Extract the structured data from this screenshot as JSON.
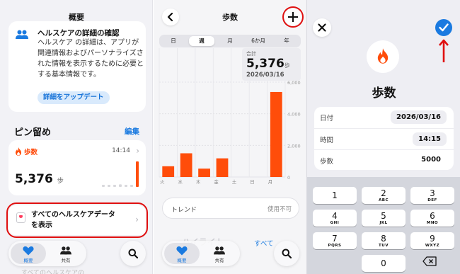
{
  "summary": {
    "title": "概要",
    "info_card": {
      "heading": "ヘルスケアの詳細の確認",
      "body": "ヘルスケア の詳細は、アプリが関連情報およびパーソナライズされた情報を表示するために必要とする基本情報です。",
      "button": "詳細をアップデート",
      "icon": "people-icon"
    },
    "pinned": {
      "title": "ピン留め",
      "edit": "編集"
    },
    "steps_card": {
      "label": "歩数",
      "time": "14:14",
      "value": "5,376",
      "unit": "歩",
      "mini_bars": [
        0.05,
        0.05,
        0.05,
        0.1,
        0.05,
        0,
        1.0
      ]
    },
    "all_data": {
      "label_line1": "すべてのヘルスケアデータ",
      "label_line2": "を表示"
    },
    "tabs": [
      {
        "label": "概要",
        "icon": "heart-icon",
        "active": true
      },
      {
        "label": "共有",
        "icon": "people-icon",
        "active": false
      }
    ],
    "ghost_text": "すべてのヘルスケアの"
  },
  "steps_detail": {
    "title": "歩数",
    "segments": [
      "日",
      "週",
      "月",
      "6か月",
      "年"
    ],
    "active_segment": "週",
    "summary": {
      "label": "合計",
      "value": "5,376",
      "unit": "歩",
      "date": "2026/03/16"
    },
    "trend": {
      "label": "トレンド",
      "state": "使用不可"
    },
    "show_all": "すべて",
    "ghost_title": "ハイライト",
    "tabs": [
      {
        "label": "概要",
        "icon": "heart-icon",
        "active": true
      },
      {
        "label": "共有",
        "icon": "people-icon",
        "active": false
      }
    ]
  },
  "chart_data": {
    "type": "bar",
    "categories": [
      "火",
      "水",
      "木",
      "金",
      "土",
      "日",
      "月"
    ],
    "values": [
      680,
      1500,
      530,
      1180,
      0,
      0,
      5376
    ],
    "ylim": [
      0,
      6000
    ],
    "y_ticks": [
      "6,000",
      "4,000",
      "2,000",
      "0"
    ],
    "bar_color": "#ff4d0a",
    "grid": true
  },
  "add_data": {
    "title": "歩数",
    "rows": [
      {
        "label": "日付",
        "value": "2026/03/16"
      },
      {
        "label": "時間",
        "value": "14:15"
      },
      {
        "label": "歩数",
        "value": "5000"
      }
    ],
    "keypad": [
      {
        "num": "1",
        "sub": ""
      },
      {
        "num": "2",
        "sub": "ABC"
      },
      {
        "num": "3",
        "sub": "DEF"
      },
      {
        "num": "4",
        "sub": "GHI"
      },
      {
        "num": "5",
        "sub": "JKL"
      },
      {
        "num": "6",
        "sub": "MNO"
      },
      {
        "num": "7",
        "sub": "PQRS"
      },
      {
        "num": "8",
        "sub": "TUV"
      },
      {
        "num": "9",
        "sub": "WXYZ"
      },
      {
        "num": "0",
        "sub": ""
      }
    ]
  },
  "colors": {
    "accent": "#1a7ae0",
    "steps_orange": "#ff4d0a",
    "annotation_red": "#e01010"
  }
}
